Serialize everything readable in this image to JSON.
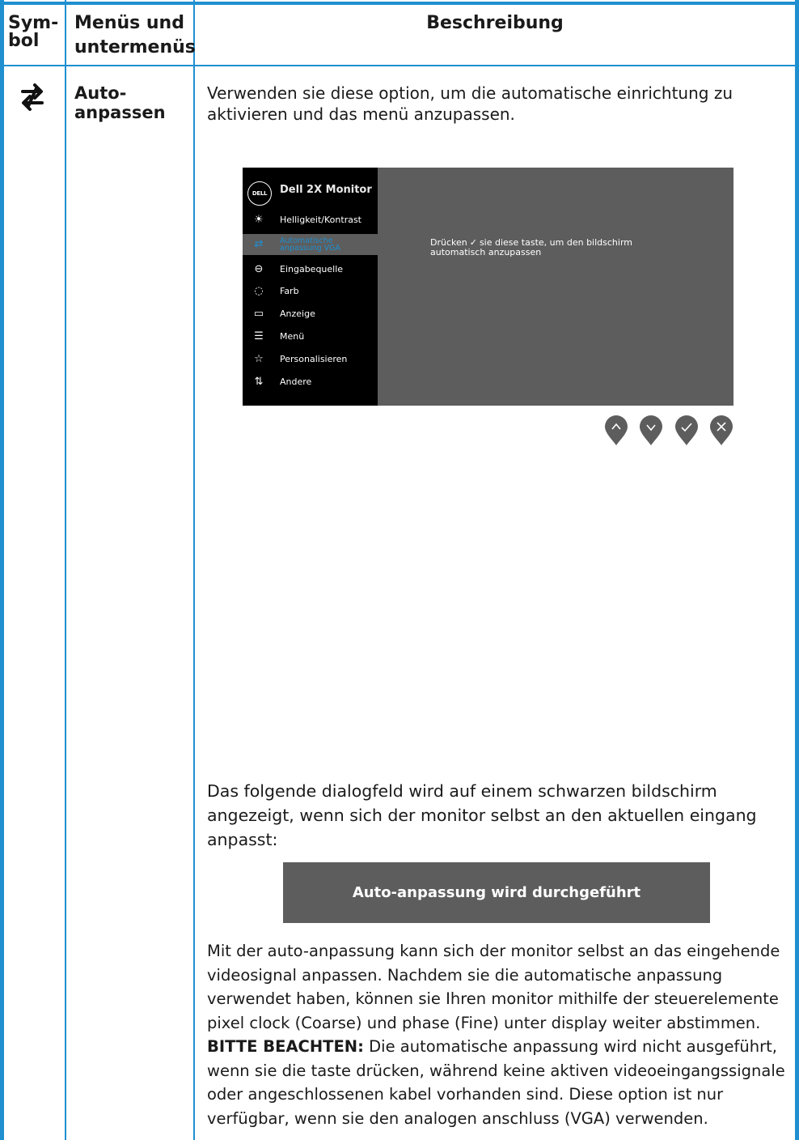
{
  "header": {
    "symbol": "Sym- bol",
    "symbol_line1": "Sym-",
    "symbol_line2": "bol",
    "menus_line1": "Menüs und",
    "menus_line2": "untermenüs",
    "description": "Beschreibung"
  },
  "row": {
    "symbol_icon": "auto-adjust-arrows-icon",
    "menu_line1": "Auto-",
    "menu_line2": "anpassen",
    "intro_line1": "Verwenden sie diese option, um die automatische einrichtung zu",
    "intro_line2": "aktivieren und das menü anzupassen.",
    "osd": {
      "logo": "DELL",
      "title": "Dell 2X Monitor",
      "items": [
        {
          "label": "Helligkeit/Kontrast",
          "icon": "brightness-icon"
        },
        {
          "label_line1": "Automatische",
          "label_line2": "anpassung VGA",
          "icon": "auto-adjust-icon",
          "active": true
        },
        {
          "label": "Eingabequelle",
          "icon": "input-source-icon"
        },
        {
          "label": "Farb",
          "icon": "color-icon"
        },
        {
          "label": "Anzeige",
          "icon": "display-icon"
        },
        {
          "label": "Menü",
          "icon": "menu-icon"
        },
        {
          "label": "Personalisieren",
          "icon": "star-icon"
        },
        {
          "label": "Andere",
          "icon": "other-icon"
        }
      ],
      "message_part1": "Drücken",
      "message_part2": "sie diese taste, um den bildschirm",
      "message_line2": "automatisch anzupassen",
      "accent_color": "#1f8fd0"
    },
    "nav_buttons": [
      "up-button",
      "down-button",
      "confirm-button",
      "close-button"
    ],
    "dialog_intro_line1": "Das folgende dialogfeld wird auf einem schwarzen bildschirm",
    "dialog_intro_line2": "angezeigt, wenn sich der monitor selbst an den aktuellen eingang",
    "dialog_intro_line3": "anpasst:",
    "dialog_text": "Auto-anpassung wird durchgeführt",
    "body_line1": "Mit der auto-anpassung kann sich der monitor selbst an das eingehende",
    "body_line2": "videosignal anpassen. Nachdem sie die automatische anpassung",
    "body_line3": "verwendet haben, können sie Ihren monitor mithilfe der steuerelemente",
    "body_line4": "pixel clock (Coarse) und phase (Fine) unter display weiter abstimmen.",
    "note_label": "BITTE BEACHTEN:",
    "note_line1": " Die automatische anpassung wird nicht ausgeführt,",
    "note_line2": "wenn sie die taste drücken, während keine aktiven videoeingangssignale",
    "note_line3": "oder angeschlossenen kabel vorhanden sind. Diese option ist nur",
    "note_line4": "verfügbar, wenn sie den analogen anschluss (VGA) verwenden."
  }
}
